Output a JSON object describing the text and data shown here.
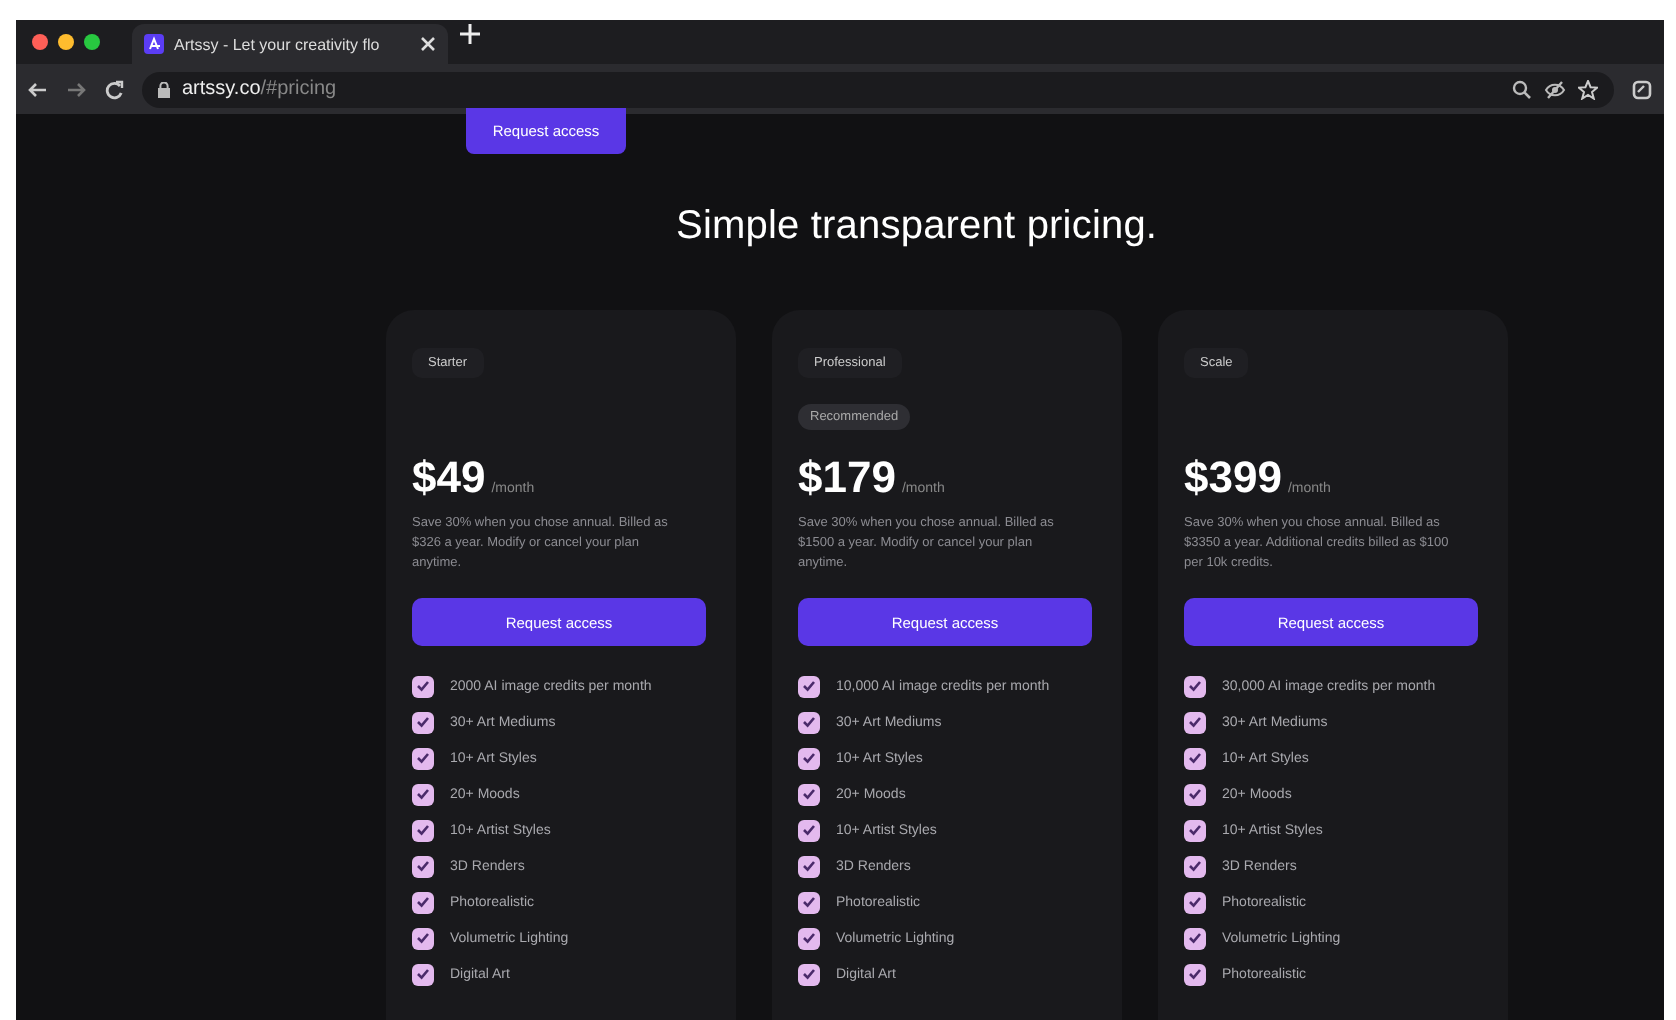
{
  "browser": {
    "tab_title": "Artssy - Let your creativity flo",
    "url_host": "artssy.co",
    "url_path": "/#pricing"
  },
  "top_button": "Request access",
  "heading": "Simple transparent pricing.",
  "plans": [
    {
      "tier": "Starter",
      "price": "$49",
      "period": "/month",
      "note": "Save 30% when you chose annual. Billed as $326 a year. Modify or cancel your plan anytime.",
      "button": "Request access",
      "features": [
        {
          "label": "2000 AI image credits per month",
          "checked": true
        },
        {
          "label": "30+ Art Mediums",
          "checked": true
        },
        {
          "label": "10+ Art Styles",
          "checked": true
        },
        {
          "label": "20+ Moods",
          "checked": true
        },
        {
          "label": "10+ Artist Styles",
          "checked": true
        },
        {
          "label": "3D Renders",
          "checked": true
        },
        {
          "label": "Photorealistic",
          "checked": true
        },
        {
          "label": "Volumetric Lighting",
          "checked": true
        },
        {
          "label": "Digital Art",
          "checked": true
        }
      ]
    },
    {
      "tier": "Professional",
      "badge": "Recommended",
      "price": "$179",
      "period": "/month",
      "note": "Save 30% when you chose annual. Billed as $1500 a year. Modify or cancel your plan anytime.",
      "button": "Request access",
      "features": [
        {
          "label": "10,000 AI image credits per month",
          "checked": true
        },
        {
          "label": "30+ Art Mediums",
          "checked": true
        },
        {
          "label": "10+ Art Styles",
          "checked": true
        },
        {
          "label": "20+ Moods",
          "checked": true
        },
        {
          "label": "10+ Artist Styles",
          "checked": true
        },
        {
          "label": "3D Renders",
          "checked": true
        },
        {
          "label": "Photorealistic",
          "checked": true
        },
        {
          "label": "Volumetric Lighting",
          "checked": true
        },
        {
          "label": "Digital Art",
          "checked": true
        }
      ]
    },
    {
      "tier": "Scale",
      "price": "$399",
      "period": "/month",
      "note": "Save 30% when you chose annual. Billed as $3350 a year. Additional credits billed as $100 per 10k credits.",
      "button": "Request access",
      "features": [
        {
          "label": "30,000 AI image credits per month",
          "checked": true
        },
        {
          "label": "30+ Art Mediums",
          "checked": true
        },
        {
          "label": "10+ Art Styles",
          "checked": true
        },
        {
          "label": "20+ Moods",
          "checked": true
        },
        {
          "label": "10+ Artist Styles",
          "checked": true
        },
        {
          "label": "3D Renders",
          "checked": true
        },
        {
          "label": "Photorealistic",
          "checked": true
        },
        {
          "label": "Volumetric Lighting",
          "checked": true
        },
        {
          "label": "Photorealistic",
          "checked": true
        }
      ]
    }
  ]
}
